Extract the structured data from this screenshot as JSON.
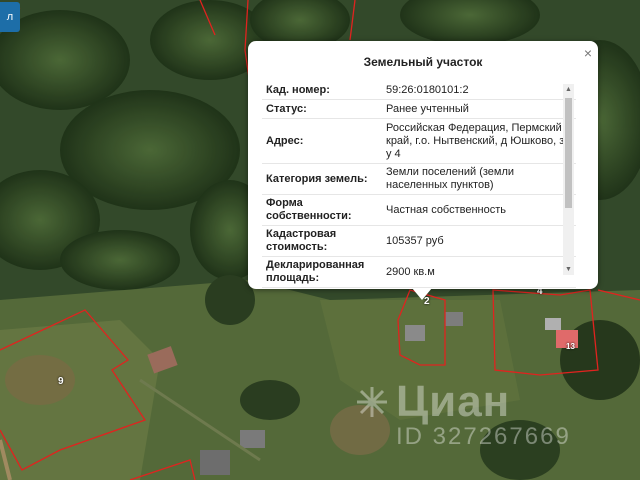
{
  "corner_button": {
    "label": "л"
  },
  "map": {
    "lot_numbers": [
      "9",
      "2",
      "4",
      "13"
    ],
    "watermark": {
      "brand": "Циан",
      "id_text": "ID 327267669"
    }
  },
  "popup": {
    "title": "Земельный участок",
    "close_label": "×",
    "rows": [
      {
        "label": "Кад. номер:",
        "value": "59:26:0180101:2"
      },
      {
        "label": "Статус:",
        "value": "Ранее учтенный"
      },
      {
        "label": "Адрес:",
        "value": "Российская Федерация, Пермский край, г.о. Нытвенский, д Юшково, з/у 4"
      },
      {
        "label": "Категория земель:",
        "value": "Земли поселений (земли населенных пунктов)"
      },
      {
        "label": "Форма собственности:",
        "value": "Частная собственность"
      },
      {
        "label": "Кадастровая стоимость:",
        "value": "105357 руб"
      },
      {
        "label": "Декларированная площадь:",
        "value": "2900 кв.м"
      }
    ]
  },
  "colors": {
    "boundary": "#e0231f",
    "accent": "#1d6ea8",
    "lot_fill": "#e06a6a"
  }
}
